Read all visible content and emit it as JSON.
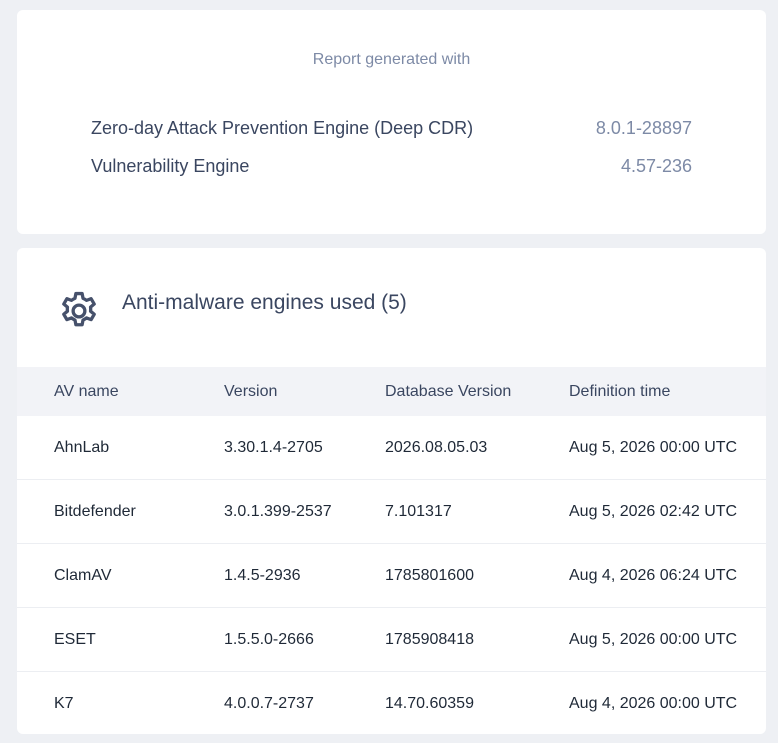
{
  "report": {
    "title": "Report generated with",
    "engines": [
      {
        "name": "Zero-day Attack Prevention Engine (Deep CDR)",
        "version": "8.0.1-28897"
      },
      {
        "name": "Vulnerability Engine",
        "version": "4.57-236"
      }
    ]
  },
  "av_section": {
    "icon": "gear-icon",
    "title": "Anti-malware engines used (5)",
    "columns": [
      "AV name",
      "Version",
      "Database Version",
      "Definition time"
    ],
    "rows": [
      [
        "AhnLab",
        "3.30.1.4-2705",
        "2026.08.05.03",
        "Aug 5, 2026 00:00 UTC"
      ],
      [
        "Bitdefender",
        "3.0.1.399-2537",
        "7.101317",
        "Aug 5, 2026 02:42 UTC"
      ],
      [
        "ClamAV",
        "1.4.5-2936",
        "1785801600",
        "Aug 4, 2026 06:24 UTC"
      ],
      [
        "ESET",
        "1.5.5.0-2666",
        "1785908418",
        "Aug 5, 2026 00:00 UTC"
      ],
      [
        "K7",
        "4.0.0.7-2737",
        "14.70.60359",
        "Aug 4, 2026 00:00 UTC"
      ]
    ]
  },
  "colors": {
    "background": "#eef0f4",
    "card": "#ffffff",
    "muted_text": "#7d8aa6",
    "primary_text": "#3a4660",
    "table_header_bg": "#f2f3f7"
  }
}
